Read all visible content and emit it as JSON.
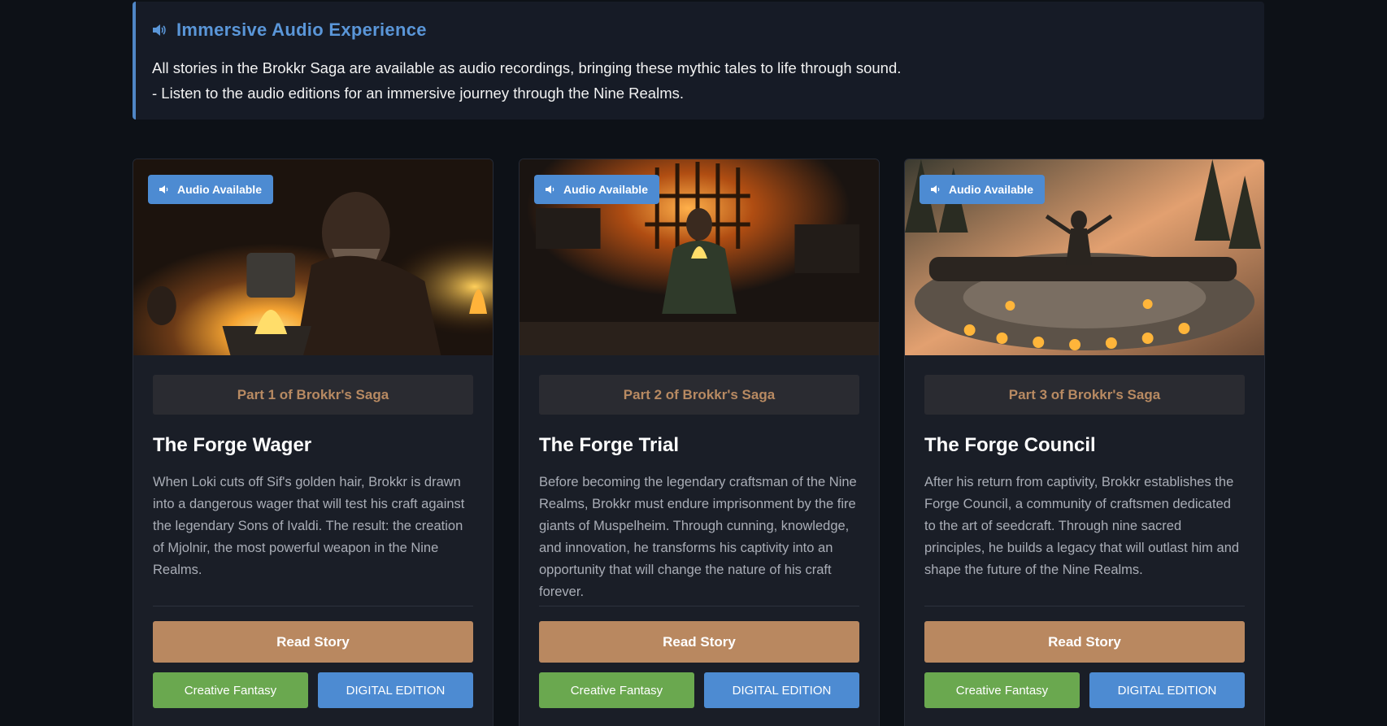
{
  "banner": {
    "title": "Immersive Audio Experience",
    "line1": "All stories in the Brokkr Saga are available as audio recordings, bringing these mythic tales to life through sound.",
    "line2": "- Listen to the audio editions for an immersive journey through the Nine Realms.",
    "icon": "speaker-icon",
    "accent": "#4f86c6"
  },
  "cards": [
    {
      "badge": "Audio Available",
      "part": "Part 1 of Brokkr's Saga",
      "title": "The Forge Wager",
      "description": "When Loki cuts off Sif's golden hair, Brokkr is drawn into a dangerous wager that will test his craft against the legendary Sons of Ivaldi. The result: the creation of Mjolnir, the most powerful weapon in the Nine Realms.",
      "read_label": "Read Story",
      "tag_genre": "Creative Fantasy",
      "tag_edition": "DIGITAL EDITION"
    },
    {
      "badge": "Audio Available",
      "part": "Part 2 of Brokkr's Saga",
      "title": "The Forge Trial",
      "description": "Before becoming the legendary craftsman of the Nine Realms, Brokkr must endure imprisonment by the fire giants of Muspelheim. Through cunning, knowledge, and innovation, he transforms his captivity into an opportunity that will change the nature of his craft forever.",
      "read_label": "Read Story",
      "tag_genre": "Creative Fantasy",
      "tag_edition": "DIGITAL EDITION"
    },
    {
      "badge": "Audio Available",
      "part": "Part 3 of Brokkr's Saga",
      "title": "The Forge Council",
      "description": "After his return from captivity, Brokkr establishes the Forge Council, a community of craftsmen dedicated to the art of seedcraft. Through nine sacred principles, he builds a legacy that will outlast him and shape the future of the Nine Realms.",
      "read_label": "Read Story",
      "tag_genre": "Creative Fantasy",
      "tag_edition": "DIGITAL EDITION"
    }
  ],
  "colors": {
    "background": "#0d1117",
    "card": "#1a1e27",
    "read_button": "#b98860",
    "genre_tag": "#6aa84f",
    "edition_tag": "#4d8bd2",
    "part_text": "#b88a62"
  }
}
